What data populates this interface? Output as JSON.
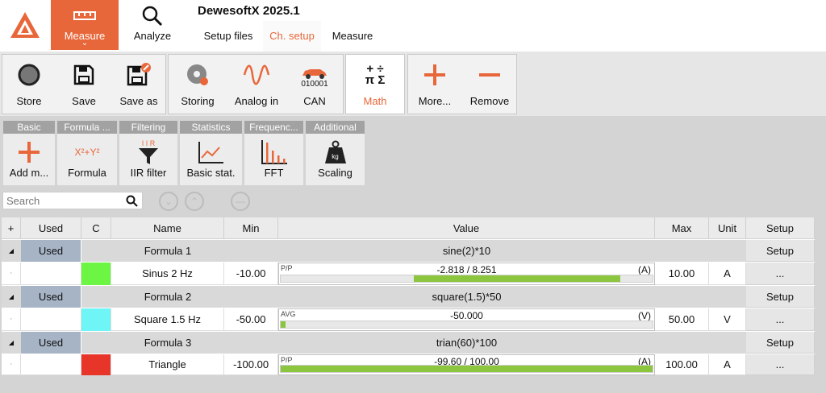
{
  "app": {
    "title": "DewesoftX 2025.1"
  },
  "modes": [
    {
      "label": "Measure",
      "icon": "ruler-icon"
    },
    {
      "label": "Analyze",
      "icon": "search-icon"
    }
  ],
  "nav_tabs": [
    "Setup files",
    "Ch. setup",
    "Measure"
  ],
  "active_tab": "Ch. setup",
  "ribbon": {
    "groups": [
      {
        "items": [
          {
            "label": "Store",
            "icon": "record-icon"
          },
          {
            "label": "Save",
            "icon": "floppy-icon"
          },
          {
            "label": "Save as",
            "icon": "floppy-edit-icon"
          }
        ]
      },
      {
        "items": [
          {
            "label": "Storing",
            "icon": "storing-icon"
          },
          {
            "label": "Analog in",
            "icon": "analog-wave-icon"
          },
          {
            "label": "CAN",
            "icon": "can-car-icon",
            "caption": "010001"
          }
        ]
      },
      {
        "items": [
          {
            "label": "Math",
            "icon": "math-operators-icon",
            "active": true
          }
        ]
      },
      {
        "items": [
          {
            "label": "More...",
            "icon": "plus-icon"
          },
          {
            "label": "Remove",
            "icon": "minus-icon"
          }
        ]
      }
    ]
  },
  "math_categories": [
    {
      "header": "Basic",
      "label": "Add m...",
      "icon": "plus-icon"
    },
    {
      "header": "Formula ...",
      "label": "Formula",
      "icon": "formula-icon",
      "icon_text": "X²+Y²"
    },
    {
      "header": "Filtering",
      "label": "IIR filter",
      "icon": "iir-filter-icon",
      "icon_text": "I I R"
    },
    {
      "header": "Statistics",
      "label": "Basic stat.",
      "icon": "statistics-chart-icon"
    },
    {
      "header": "Frequenc...",
      "label": "FFT",
      "icon": "fft-bars-icon"
    },
    {
      "header": "Additional",
      "label": "Scaling",
      "icon": "weight-kg-icon",
      "icon_text": "kg"
    }
  ],
  "search": {
    "placeholder": "Search"
  },
  "table": {
    "headers": {
      "plus": "+",
      "used": "Used",
      "c": "C",
      "name": "Name",
      "min": "Min",
      "value": "Value",
      "max": "Max",
      "unit": "Unit",
      "setup": "Setup"
    },
    "groups": [
      {
        "used": "Used",
        "name": "Formula 1",
        "expression": "sine(2)*10",
        "setup": "Setup",
        "channel": {
          "color": "#6cf542",
          "name": "Sinus 2 Hz",
          "min": "-10.00",
          "mode": "P/P",
          "value": "-2.818 / 8.251",
          "unit_paren": "(A)",
          "bar_from": 0.359,
          "bar_to": 0.913,
          "max": "10.00",
          "unit": "A",
          "setup": "..."
        }
      },
      {
        "used": "Used",
        "name": "Formula 2",
        "expression": "square(1.5)*50",
        "setup": "Setup",
        "channel": {
          "color": "#6ff5f5",
          "name": "Square 1.5 Hz",
          "min": "-50.00",
          "mode": "AVG",
          "value": "-50.000",
          "unit_paren": "(V)",
          "bar_from": 0.0,
          "bar_to": 0.012,
          "max": "50.00",
          "unit": "V",
          "setup": "..."
        }
      },
      {
        "used": "Used",
        "name": "Formula 3",
        "expression": "trian(60)*100",
        "setup": "Setup",
        "channel": {
          "color": "#e8352a",
          "name": "Triangle",
          "min": "-100.00",
          "mode": "P/P",
          "value": "-99.60 / 100.00",
          "unit_paren": "(A)",
          "bar_from": 0.0,
          "bar_to": 1.0,
          "max": "100.00",
          "unit": "A",
          "setup": "..."
        }
      }
    ]
  },
  "colors": {
    "accent": "#e8673a",
    "used_cell": "#a6b4c6",
    "bar_fill": "#8cc63f"
  }
}
